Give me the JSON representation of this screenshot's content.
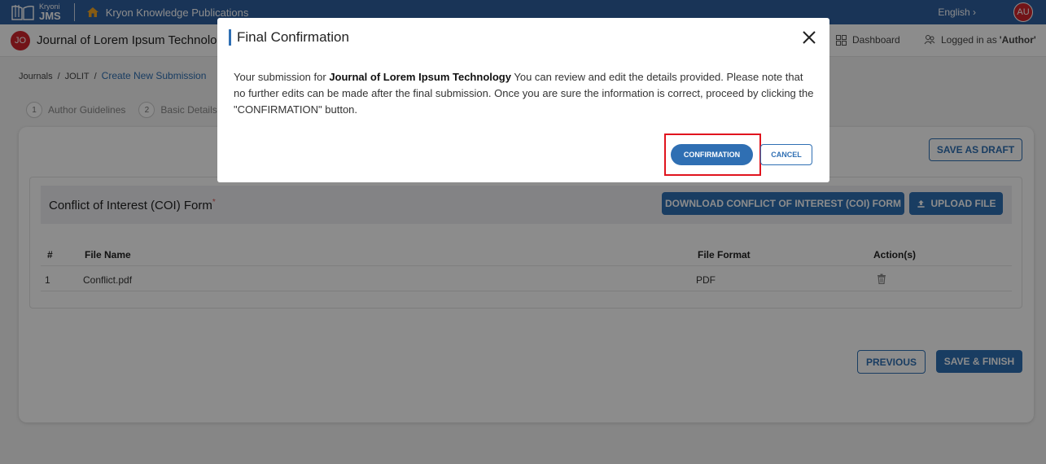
{
  "topbar": {
    "logo_small": "Kryoni",
    "logo_big": "JMS",
    "org_name": "Kryon Knowledge Publications",
    "language": "English ›",
    "user_initials": "AU"
  },
  "header": {
    "journal_initials": "JO",
    "journal_title": "Journal of Lorem Ipsum Technology",
    "dashboard_label": "Dashboard",
    "logged_in_prefix": "Logged in as",
    "logged_in_role": "'Author'"
  },
  "breadcrumb": {
    "items": [
      "Journals",
      "JOLIT",
      "Create New Submission"
    ],
    "separator": "/"
  },
  "steps": [
    {
      "num": "1",
      "label": "Author Guidelines"
    },
    {
      "num": "2",
      "label": "Basic Details"
    }
  ],
  "main": {
    "save_draft_label": "SAVE AS DRAFT",
    "coi_title": "Conflict of Interest (COI) Form",
    "coi_required_mark": "*",
    "download_label": "DOWNLOAD CONFLICT OF INTEREST (COI) FORM",
    "upload_label": "UPLOAD FILE",
    "table": {
      "headers": {
        "num": "#",
        "file_name": "File Name",
        "file_format": "File Format",
        "actions": "Action(s)"
      },
      "rows": [
        {
          "num": "1",
          "file_name": "Conflict.pdf",
          "file_format": "PDF"
        }
      ]
    },
    "previous_label": "PREVIOUS",
    "finish_label": "SAVE & FINISH"
  },
  "modal": {
    "title": "Final Confirmation",
    "body_prefix": "Your submission for ",
    "body_journal": "Journal of Lorem Ipsum Technology",
    "body_rest": " You can review and edit the details provided. Please note that no further edits can be made after the final submission. Once you are sure the information is correct, proceed by clicking the \"CONFIRMATION\" button.",
    "confirm_label": "CONFIRMATION",
    "cancel_label": "CANCEL"
  },
  "colors": {
    "primary": "#2f6fb3",
    "topbar": "#2f5f9e",
    "avatar": "#d0262d",
    "highlight": "#e0141e"
  },
  "icons": [
    "book-logo-icon",
    "home-icon",
    "grid-icon",
    "users-icon",
    "trash-icon",
    "upload-icon",
    "close-icon"
  ]
}
